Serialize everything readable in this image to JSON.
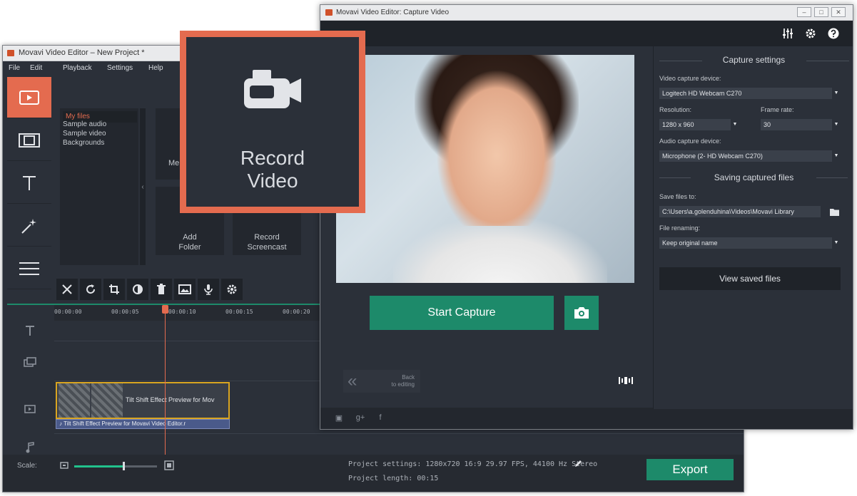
{
  "editor": {
    "title": "Movavi Video Editor – New Project *",
    "menu": [
      "File",
      "Edit",
      "Playback",
      "Settings",
      "Help"
    ],
    "files": [
      "My files",
      "Sample audio",
      "Sample video",
      "Backgrounds"
    ],
    "tile_partial": "Me",
    "tile_add_folder_1": "Add",
    "tile_add_folder_2": "Folder",
    "tile_record_screencast_1": "Record",
    "tile_record_screencast_2": "Screencast",
    "collapse_glyph": "‹",
    "ruler": [
      "00:00:00",
      "00:00:05",
      "00:00:10",
      "00:00:15",
      "00:00:20"
    ],
    "clip_label": "Tilt Shift Effect Preview for Mov",
    "audio_clip_label": "♪ Tilt Shift Effect Preview for Movavi Video Editor.r",
    "scale_label": "Scale:",
    "scale_level": 0.6,
    "project_settings": "Project settings:  1280x720 16:9 29.97 FPS, 44100 Hz Stereo",
    "project_length": "Project length:   00:15",
    "export_label": "Export",
    "accent": "#e46b4f",
    "green": "#1d8a6a"
  },
  "callout": {
    "label_line1": "Record",
    "label_line2": "Video"
  },
  "capture": {
    "title": "Movavi Video Editor: Capture Video",
    "start_capture_label": "Start Capture",
    "back_line1": "Back",
    "back_line2": "to editing",
    "settings": {
      "capture_settings_title": "Capture settings",
      "video_device_label": "Video capture device:",
      "video_device_value": "Logitech HD Webcam C270",
      "resolution_label": "Resolution:",
      "resolution_value": "1280 x 960",
      "frame_rate_label": "Frame rate:",
      "frame_rate_value": "30",
      "audio_device_label": "Audio capture device:",
      "audio_device_value": "Microphone (2- HD Webcam C270)",
      "saving_title": "Saving captured files",
      "save_to_label": "Save files to:",
      "save_to_value": "C:\\Users\\a.golenduhina\\Videos\\Movavi Library",
      "renaming_label": "File renaming:",
      "renaming_value": "Keep original name",
      "view_saved_label": "View saved files"
    }
  }
}
